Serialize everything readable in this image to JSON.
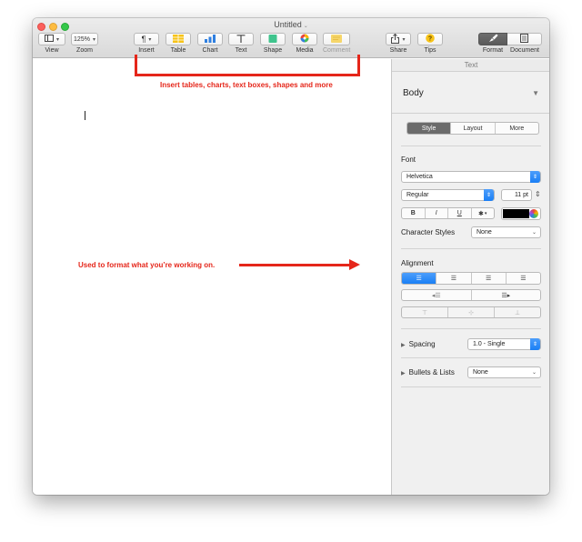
{
  "window": {
    "title": "Untitled"
  },
  "toolbar": {
    "view": {
      "label": "View"
    },
    "zoom": {
      "label": "Zoom",
      "value": "125%"
    },
    "insert": {
      "label": "Insert",
      "icon": "pilcrow-icon"
    },
    "table": {
      "label": "Table",
      "icon": "table-icon"
    },
    "chart": {
      "label": "Chart",
      "icon": "bar-chart-icon"
    },
    "text": {
      "label": "Text",
      "icon": "text-box-icon"
    },
    "shape": {
      "label": "Shape",
      "icon": "shape-icon"
    },
    "media": {
      "label": "Media",
      "icon": "media-icon"
    },
    "comment": {
      "label": "Comment",
      "icon": "comment-icon"
    },
    "share": {
      "label": "Share",
      "icon": "share-icon"
    },
    "tips": {
      "label": "Tips",
      "icon": "question-icon"
    },
    "format": {
      "label": "Format",
      "icon": "paintbrush-icon"
    },
    "document": {
      "label": "Document",
      "icon": "document-icon"
    }
  },
  "sidebar": {
    "header": "Text",
    "paragraph_style": "Body",
    "tabs": [
      {
        "label": "Style",
        "active": true
      },
      {
        "label": "Layout",
        "active": false
      },
      {
        "label": "More",
        "active": false
      }
    ],
    "font": {
      "section_label": "Font",
      "family": "Helvetica",
      "typeface": "Regular",
      "size": "11 pt",
      "bold": "B",
      "italic": "I",
      "underline": "U",
      "color": "#000000"
    },
    "character_styles": {
      "label": "Character Styles",
      "value": "None"
    },
    "alignment": {
      "label": "Alignment"
    },
    "spacing": {
      "label": "Spacing",
      "value": "1.0 - Single"
    },
    "bullets": {
      "label": "Bullets & Lists",
      "value": "None"
    }
  },
  "annotations": {
    "insert_note": "Insert tables, charts, text boxes, shapes and more",
    "format_note": "Used to format what you’re working on."
  },
  "colors": {
    "accent_blue": "#1a7ff5",
    "annotation_red": "#e5261a"
  }
}
